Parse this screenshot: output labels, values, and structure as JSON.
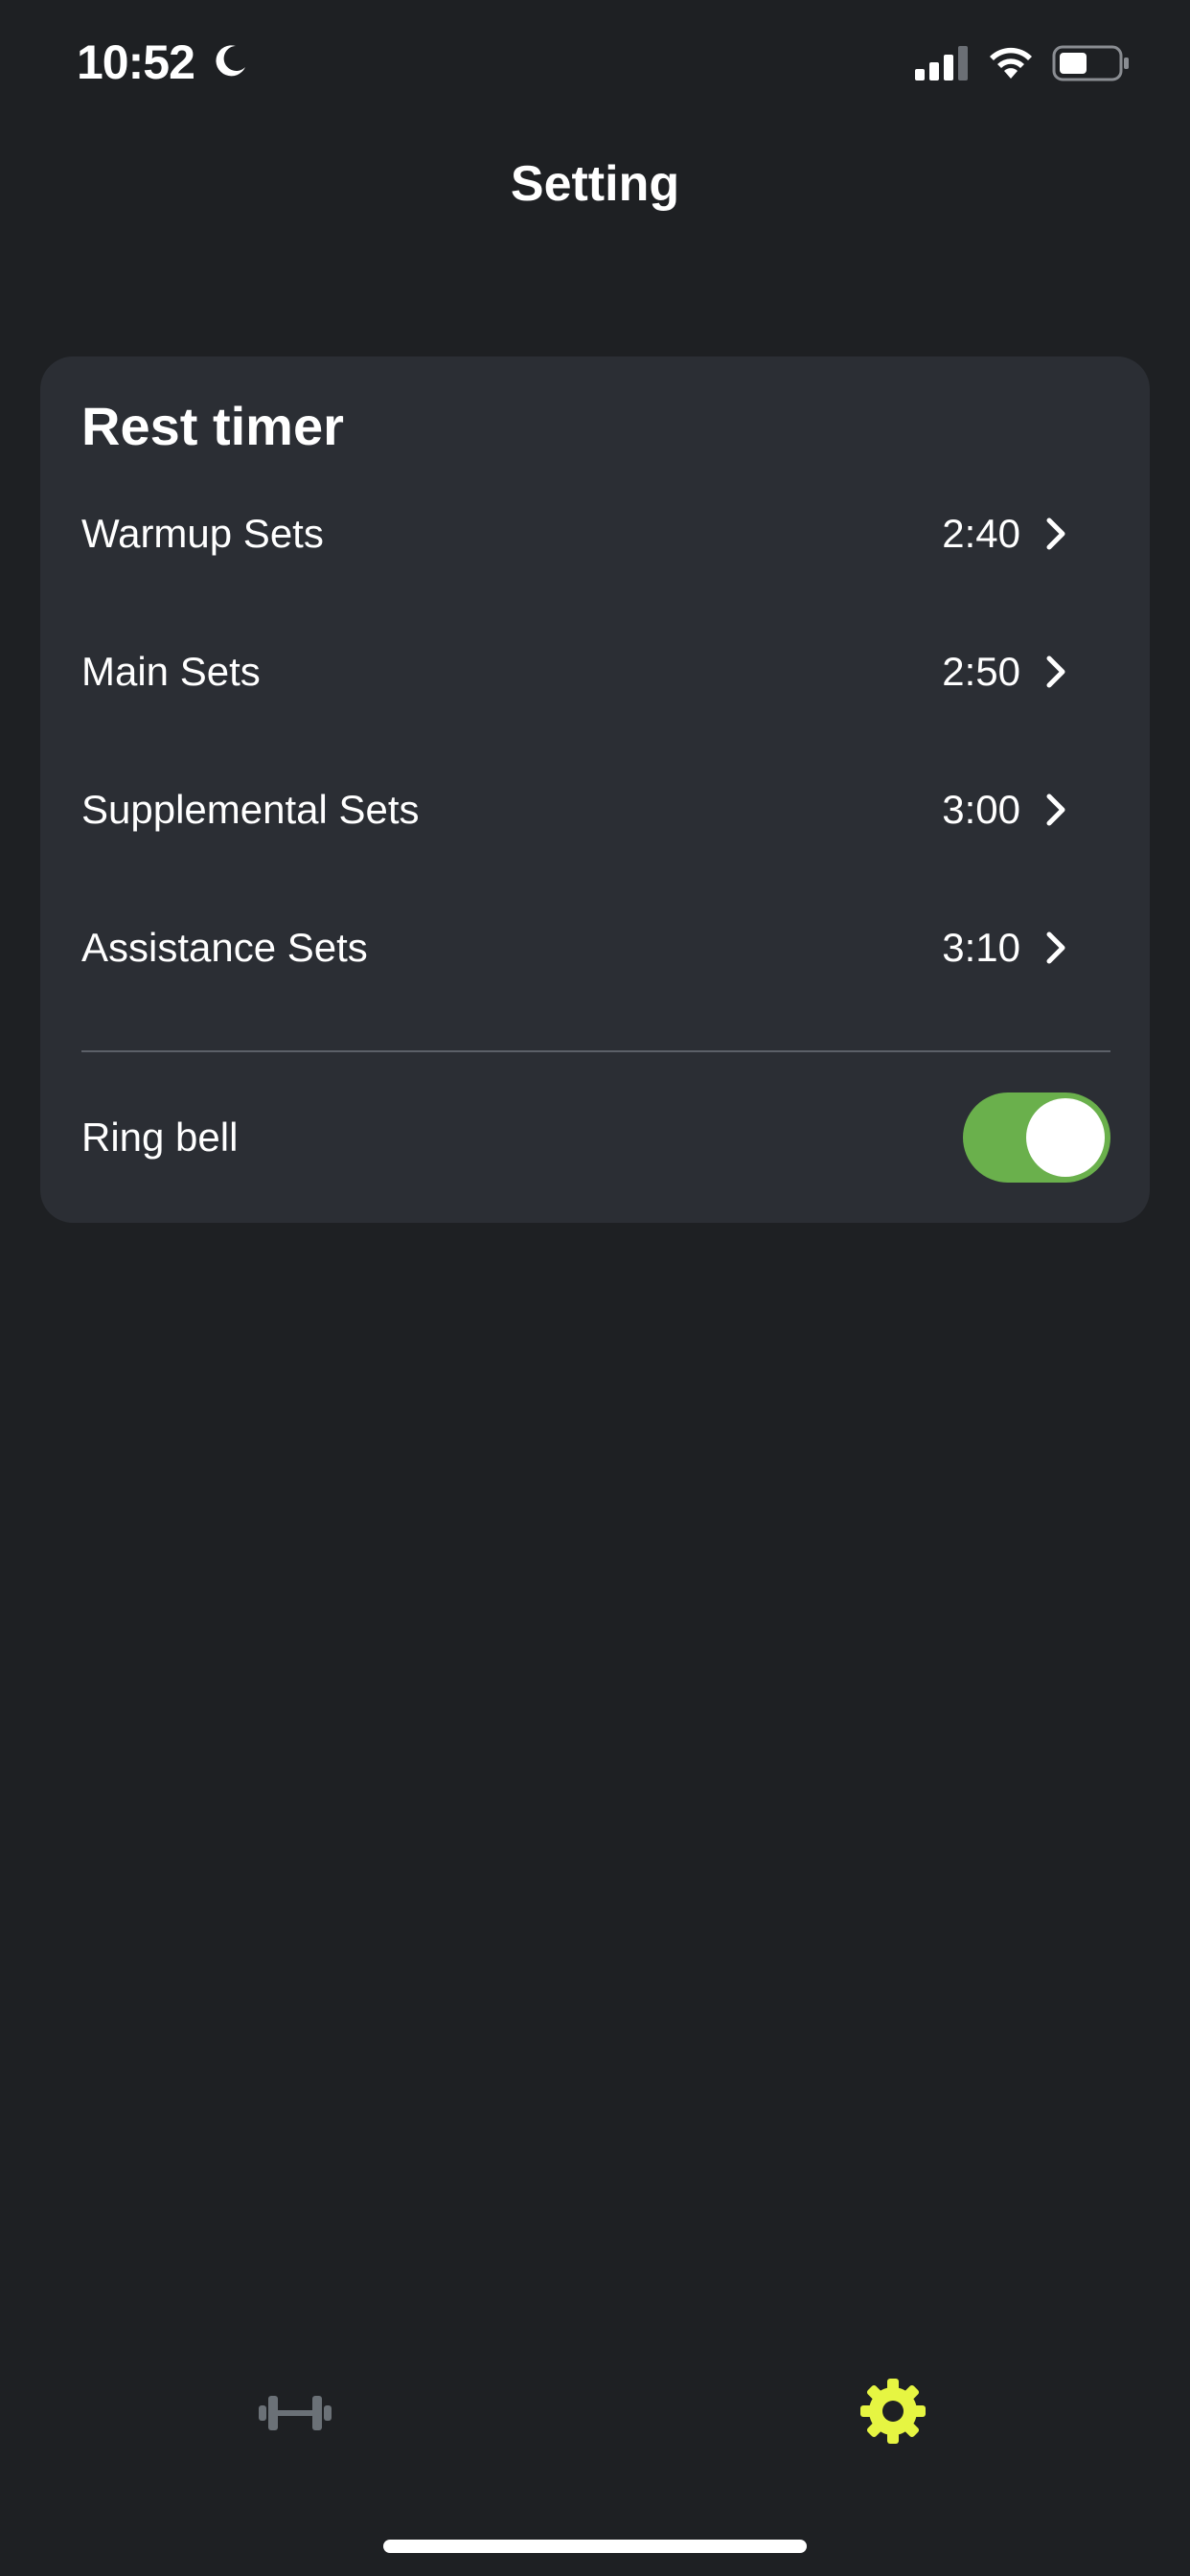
{
  "status_bar": {
    "time": "10:52",
    "icons": [
      "moon-icon",
      "signal-icon",
      "wifi-icon",
      "battery-icon"
    ]
  },
  "header": {
    "title": "Setting"
  },
  "rest_timer": {
    "title": "Rest timer",
    "items": [
      {
        "label": "Warmup Sets",
        "value": "2:40"
      },
      {
        "label": "Main Sets",
        "value": "2:50"
      },
      {
        "label": "Supplemental Sets",
        "value": "3:00"
      },
      {
        "label": "Assistance Sets",
        "value": "3:10"
      }
    ],
    "ring_bell": {
      "label": "Ring bell",
      "enabled": true
    }
  },
  "tab_bar": {
    "tabs": [
      {
        "icon": "dumbbell-icon",
        "active": false
      },
      {
        "icon": "gear-icon",
        "active": true
      }
    ]
  },
  "colors": {
    "background": "#1e2023",
    "card": "#2b2e34",
    "toggle_on": "#6ab04c",
    "active_tab": "#e6f542",
    "inactive_tab": "#6b7177"
  }
}
